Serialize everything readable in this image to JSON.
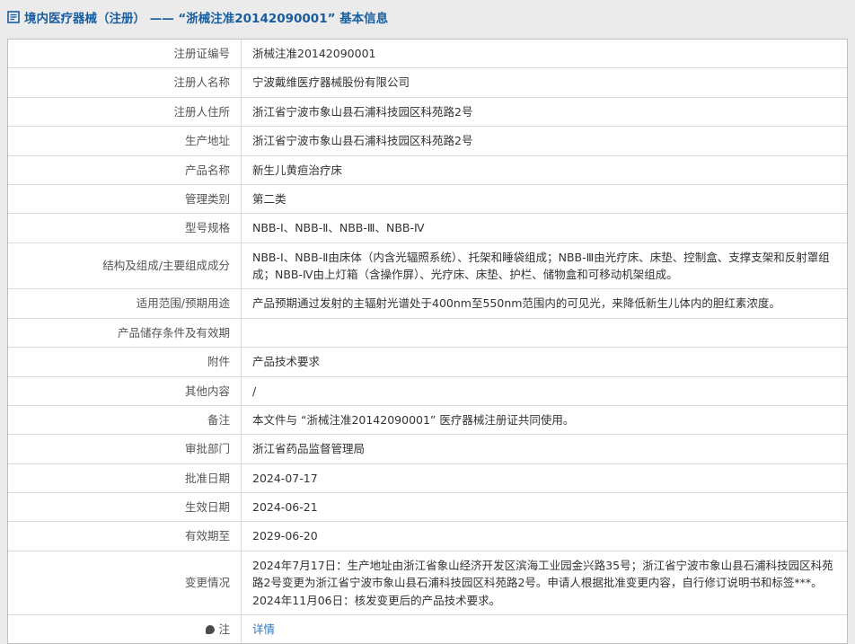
{
  "colors": {
    "title_blue": "#1a5d9e",
    "link_blue": "#2a79c8",
    "page_background": "#ebebeb",
    "table_border": "#bfbfbf"
  },
  "header": {
    "icon": "document-icon",
    "title": "境内医疗器械（注册） —— “浙械注准20142090001” 基本信息"
  },
  "table": {
    "rows": [
      {
        "label": "注册证编号",
        "value": "浙械注准20142090001"
      },
      {
        "label": "注册人名称",
        "value": "宁波戴维医疗器械股份有限公司"
      },
      {
        "label": "注册人住所",
        "value": "浙江省宁波市象山县石浦科技园区科苑路2号"
      },
      {
        "label": "生产地址",
        "value": "浙江省宁波市象山县石浦科技园区科苑路2号"
      },
      {
        "label": "产品名称",
        "value": "新生儿黄疸治疗床"
      },
      {
        "label": "管理类别",
        "value": "第二类"
      },
      {
        "label": "型号规格",
        "value": "NBB-Ⅰ、NBB-Ⅱ、NBB-Ⅲ、NBB-Ⅳ"
      },
      {
        "label": "结构及组成/主要组成成分",
        "value": "NBB-Ⅰ、NBB-Ⅱ由床体（内含光辐照系统）、托架和睡袋组成；NBB-Ⅲ由光疗床、床垫、控制盒、支撑支架和反射罩组成；NBB-Ⅳ由上灯箱（含操作屏）、光疗床、床垫、护栏、储物盒和可移动机架组成。"
      },
      {
        "label": "适用范围/预期用途",
        "value": "产品预期通过发射的主辐射光谱处于400nm至550nm范围内的可见光，来降低新生儿体内的胆红素浓度。"
      },
      {
        "label": "产品储存条件及有效期",
        "value": ""
      },
      {
        "label": "附件",
        "value": "产品技术要求"
      },
      {
        "label": "其他内容",
        "value": "/"
      },
      {
        "label": "备注",
        "value": "本文件与 “浙械注准20142090001” 医疗器械注册证共同使用。"
      },
      {
        "label": "审批部门",
        "value": "浙江省药品监督管理局"
      },
      {
        "label": "批准日期",
        "value": "2024-07-17"
      },
      {
        "label": "生效日期",
        "value": "2024-06-21"
      },
      {
        "label": "有效期至",
        "value": "2029-06-20"
      },
      {
        "label": "变更情况",
        "value": "2024年7月17日：生产地址由浙江省象山经济开发区滨海工业园金兴路35号；浙江省宁波市象山县石浦科技园区科苑路2号变更为浙江省宁波市象山县石浦科技园区科苑路2号。申请人根据批准变更内容，自行修订说明书和标签***。\n2024年11月06日：核发变更后的产品技术要求。"
      },
      {
        "label": "注",
        "value": "详情"
      }
    ]
  }
}
